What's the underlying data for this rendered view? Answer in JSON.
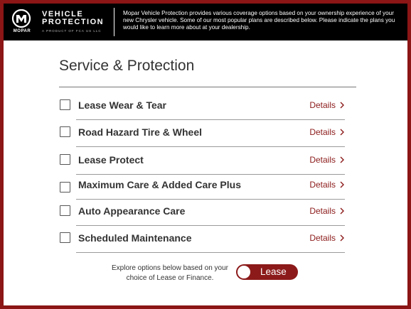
{
  "header": {
    "logo_word": "MOPAR",
    "brand_line1": "VEHICLE",
    "brand_line2": "PROTECTION",
    "brand_tagline": "A PRODUCT OF FCA US LLC",
    "intro": "Mopar Vehicle Protection provides various coverage options based on your ownership experience of your new Chrysler vehicle. Some of our most popular plans are described below. Please indicate the plans you would like to learn more about at your dealership."
  },
  "main": {
    "title": "Service & Protection",
    "details_label": "Details",
    "plans": [
      {
        "label": "Lease Wear & Tear",
        "checked": false
      },
      {
        "label": "Road Hazard Tire & Wheel",
        "checked": false
      },
      {
        "label": "Lease Protect",
        "checked": false
      },
      {
        "label": "Maximum Care & Added Care Plus",
        "checked": false
      },
      {
        "label": "Auto Appearance Care",
        "checked": false
      },
      {
        "label": "Scheduled Maintenance",
        "checked": false
      }
    ]
  },
  "footer": {
    "explore_text": "Explore options below based on your choice of Lease or Finance.",
    "toggle_label": "Lease"
  },
  "colors": {
    "accent": "#8c1a1a",
    "border": "#8c1515",
    "header_bg": "#000000"
  }
}
